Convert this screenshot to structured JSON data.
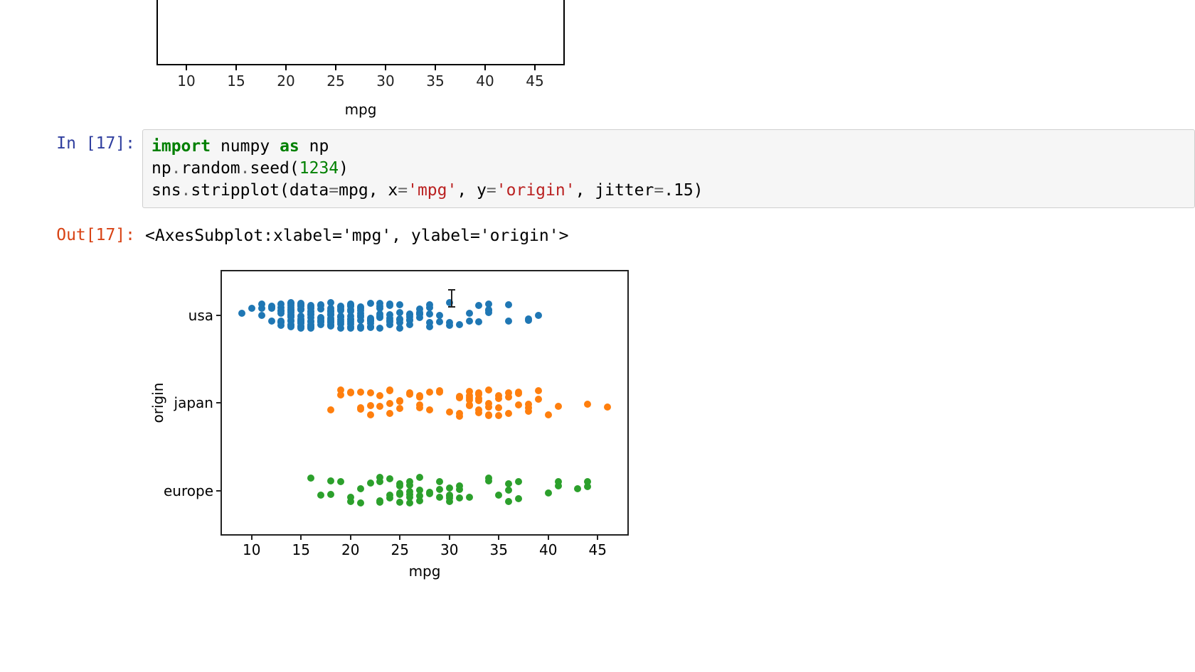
{
  "prev_chart": {
    "xlabel": "mpg",
    "xticks": [
      10,
      15,
      20,
      25,
      30,
      35,
      40,
      45
    ]
  },
  "cell_in": {
    "prompt": "In [17]:",
    "code_tokens": [
      {
        "t": "import",
        "c": "kw"
      },
      {
        "t": " "
      },
      {
        "t": "numpy",
        "c": "nm"
      },
      {
        "t": " "
      },
      {
        "t": "as",
        "c": "kw"
      },
      {
        "t": " "
      },
      {
        "t": "np",
        "c": "nm"
      },
      {
        "t": "\n"
      },
      {
        "t": "np",
        "c": "nm"
      },
      {
        "t": ".",
        "c": "op"
      },
      {
        "t": "random",
        "c": "nm"
      },
      {
        "t": ".",
        "c": "op"
      },
      {
        "t": "seed",
        "c": "nm"
      },
      {
        "t": "("
      },
      {
        "t": "1234",
        "c": "int"
      },
      {
        "t": ")"
      },
      {
        "t": "\n"
      },
      {
        "t": "sns",
        "c": "nm"
      },
      {
        "t": ".",
        "c": "op"
      },
      {
        "t": "stripplot",
        "c": "nm"
      },
      {
        "t": "("
      },
      {
        "t": "data",
        "c": "nm"
      },
      {
        "t": "=",
        "c": "op"
      },
      {
        "t": "mpg",
        "c": "nm"
      },
      {
        "t": ", "
      },
      {
        "t": "x",
        "c": "nm"
      },
      {
        "t": "=",
        "c": "op"
      },
      {
        "t": "'mpg'",
        "c": "str"
      },
      {
        "t": ", "
      },
      {
        "t": "y",
        "c": "nm"
      },
      {
        "t": "=",
        "c": "op"
      },
      {
        "t": "'origin'",
        "c": "str"
      },
      {
        "t": ", "
      },
      {
        "t": "jitter",
        "c": "nm"
      },
      {
        "t": "=",
        "c": "op"
      },
      {
        "t": ".15"
      },
      {
        "t": ")"
      }
    ]
  },
  "cell_out": {
    "prompt": "Out[17]:",
    "text": "<AxesSubplot:xlabel='mpg', ylabel='origin'>"
  },
  "chart_data": {
    "type": "strip",
    "xlabel": "mpg",
    "ylabel": "origin",
    "xticks": [
      10,
      15,
      20,
      25,
      30,
      35,
      40,
      45
    ],
    "xlim": [
      7,
      48
    ],
    "categories": [
      "usa",
      "japan",
      "europe"
    ],
    "colors": [
      "#1f77b4",
      "#ff7f0e",
      "#2ca02c"
    ],
    "jitter": 0.15,
    "series": [
      {
        "name": "usa",
        "x": [
          9,
          10,
          11,
          11,
          11,
          12,
          12,
          12,
          12,
          13,
          13,
          13,
          13,
          13,
          13,
          13,
          13,
          13,
          14,
          14,
          14,
          14,
          14,
          14,
          14,
          14,
          14,
          14,
          14,
          14,
          14,
          14,
          14,
          14,
          14,
          14,
          15,
          15,
          15,
          15,
          15,
          15,
          15,
          15,
          15,
          15,
          15,
          15,
          15,
          15,
          15,
          15,
          15,
          16,
          16,
          16,
          16,
          16,
          16,
          16,
          16,
          16,
          16,
          16,
          16,
          16,
          16,
          16,
          16,
          17,
          17,
          17,
          17,
          17,
          17,
          17,
          17,
          17,
          17,
          18,
          18,
          18,
          18,
          18,
          18,
          18,
          18,
          18,
          18,
          18,
          18,
          18,
          18,
          18,
          18,
          19,
          19,
          19,
          19,
          19,
          19,
          19,
          19,
          19,
          19,
          19,
          20,
          20,
          20,
          20,
          20,
          20,
          20,
          20,
          20,
          20,
          20,
          20,
          20,
          21,
          21,
          21,
          21,
          21,
          21,
          21,
          21,
          21,
          22,
          22,
          22,
          22,
          22,
          22,
          22,
          22,
          22,
          22,
          23,
          23,
          23,
          23,
          23,
          23,
          23,
          24,
          24,
          24,
          24,
          24,
          24,
          24,
          25,
          25,
          25,
          25,
          25,
          25,
          26,
          26,
          26,
          26,
          26,
          26,
          27,
          27,
          27,
          27,
          27,
          28,
          28,
          28,
          28,
          28,
          29,
          29,
          30,
          30,
          30,
          31,
          32,
          32,
          33,
          33,
          34,
          34,
          34,
          34,
          36,
          36,
          38,
          38,
          39
        ]
      },
      {
        "name": "japan",
        "x": [
          18,
          19,
          19,
          20,
          20,
          21,
          21,
          21,
          22,
          22,
          22,
          23,
          23,
          24,
          24,
          24,
          24,
          25,
          25,
          25,
          26,
          26,
          27,
          27,
          27,
          27,
          28,
          28,
          29,
          29,
          30,
          31,
          31,
          31,
          31,
          31,
          32,
          32,
          32,
          32,
          32,
          32,
          33,
          33,
          33,
          33,
          33,
          33,
          34,
          34,
          34,
          34,
          34,
          35,
          35,
          35,
          35,
          36,
          36,
          36,
          37,
          37,
          37,
          38,
          38,
          38,
          39,
          39,
          40,
          41,
          44,
          46
        ]
      },
      {
        "name": "europe",
        "x": [
          16,
          17,
          18,
          18,
          19,
          20,
          20,
          21,
          21,
          22,
          23,
          23,
          23,
          23,
          24,
          24,
          24,
          25,
          25,
          25,
          25,
          25,
          26,
          26,
          26,
          26,
          26,
          26,
          27,
          27,
          27,
          27,
          28,
          28,
          29,
          29,
          29,
          30,
          30,
          30,
          30,
          30,
          31,
          31,
          31,
          32,
          34,
          34,
          35,
          36,
          36,
          36,
          37,
          37,
          40,
          41,
          41,
          43,
          44,
          44
        ]
      }
    ]
  }
}
